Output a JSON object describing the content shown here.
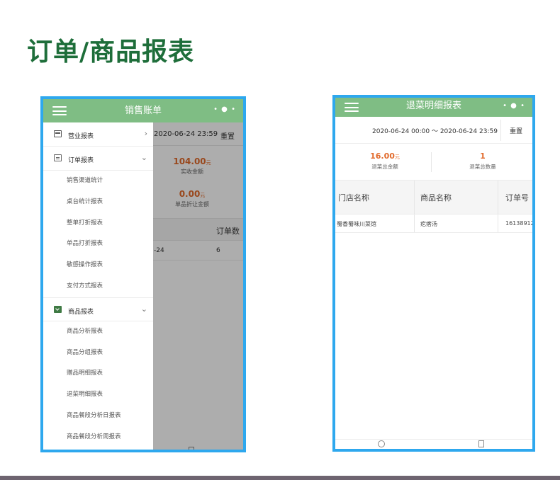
{
  "page_title": "订单/商品报表",
  "left_phone": {
    "header_title": "销售账单",
    "header_dots": "• ● •",
    "background": {
      "date_range": "2020-06-24 23:59",
      "reset": "重置",
      "stat1_value": "104.00",
      "stat1_unit": "元",
      "stat1_label": "实收金额",
      "stat2_value": "0.00",
      "stat2_unit": "元",
      "stat2_label": "单品折让金额",
      "column_header": "订单数",
      "cell_date": "-24",
      "cell_count": "6"
    },
    "drawer": {
      "group1_label": "营业报表",
      "group1_chevron": "›",
      "group2_label": "订单报表",
      "group2_chevron": "⌄",
      "group2_items": [
        "销售渠道统计",
        "桌台统计报表",
        "整单打折报表",
        "单品打折报表",
        "敏感操作报表",
        "支付方式报表"
      ],
      "group3_label": "商品报表",
      "group3_chevron": "⌄",
      "group3_items": [
        "商品分析报表",
        "商品分组报表",
        "赠品明细报表",
        "退菜明细报表",
        "商品餐段分析日报表",
        "商品餐段分析周报表"
      ]
    }
  },
  "right_phone": {
    "header_title": "退菜明细报表",
    "header_dots": "• ● •",
    "date_range": "2020-06-24 00:00  ～  2020-06-24 23:59",
    "reset": "重置",
    "stat1_value": "16.00",
    "stat1_unit": "元",
    "stat1_label": "退菜总金额",
    "stat2_value": "1",
    "stat2_label": "退菜总数量",
    "table_headers": [
      "门店名称",
      "商品名称",
      "订单号"
    ],
    "table_row": [
      "蜀香蜀味川菜馆",
      "疙瘩汤",
      "16138912"
    ]
  }
}
